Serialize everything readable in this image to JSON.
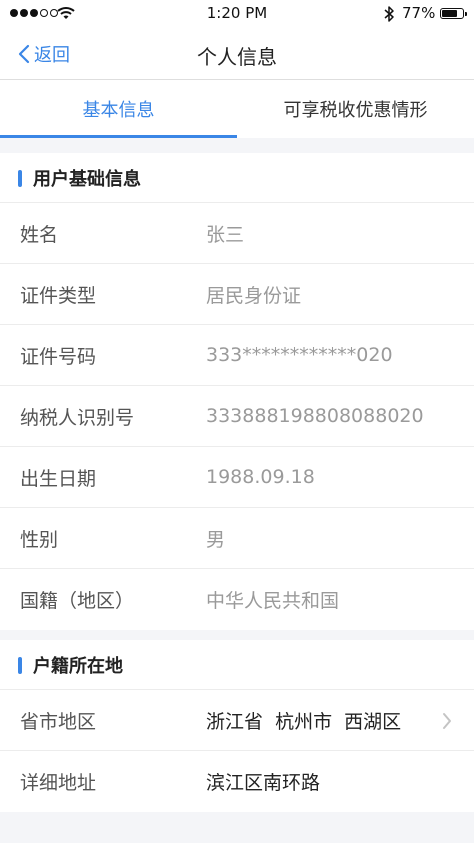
{
  "status_bar": {
    "time": "1:20 PM",
    "battery_percent": "77%",
    "battery_level": 0.77,
    "signal_bars_filled": 3,
    "signal_bars_total": 5
  },
  "nav": {
    "back_label": "返回",
    "title": "个人信息"
  },
  "tabs": [
    {
      "label": "基本信息",
      "active": true
    },
    {
      "label": "可享税收优惠情形",
      "active": false
    }
  ],
  "basic_info": {
    "title": "用户基础信息",
    "rows": [
      {
        "label": "姓名",
        "value": "张三"
      },
      {
        "label": "证件类型",
        "value": "居民身份证"
      },
      {
        "label": "证件号码",
        "value": "333************020"
      },
      {
        "label": "纳税人识别号",
        "value": "333888198808088020"
      },
      {
        "label": "出生日期",
        "value": "1988.09.18"
      },
      {
        "label": "性别",
        "value": "男"
      },
      {
        "label": "国籍（地区）",
        "value": "中华人民共和国"
      }
    ]
  },
  "household": {
    "title": "户籍所在地",
    "rows": [
      {
        "label": "省市地区",
        "value": "浙江省  杭州市  西湖区"
      },
      {
        "label": "详细地址",
        "value": "滨江区南环路"
      }
    ]
  },
  "colors": {
    "accent": "#3a86e6",
    "background": "#f4f5f8",
    "muted_text": "#9a9a9a"
  },
  "icons": {
    "back": "chevron-left-icon",
    "disclosure": "chevron-right-icon",
    "wifi": "wifi-icon",
    "bluetooth": "bluetooth-icon",
    "battery": "battery-icon"
  }
}
